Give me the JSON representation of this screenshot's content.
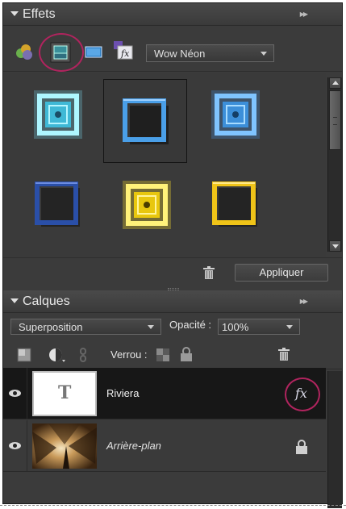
{
  "effects_panel": {
    "title": "Effets",
    "category_dropdown": {
      "selected": "Wow Néon"
    },
    "tabs": [
      {
        "icon": "filters-icon"
      },
      {
        "icon": "layer-styles-icon",
        "active": true
      },
      {
        "icon": "photo-effects-icon"
      },
      {
        "icon": "fx-all-icon"
      }
    ],
    "thumbnails": [
      {
        "style": "neon-glow-cyan"
      },
      {
        "style": "blue-bevel-shadow",
        "selected": true
      },
      {
        "style": "neon-glow-blue"
      },
      {
        "style": "dark-blue-bevel"
      },
      {
        "style": "neon-glow-yellow"
      },
      {
        "style": "yellow-bevel-shadow"
      }
    ],
    "apply_label": "Appliquer"
  },
  "layers_panel": {
    "title": "Calques",
    "blend_mode": "Superposition",
    "opacity_label": "Opacité :",
    "opacity_value": "100%",
    "lock_label": "Verrou :",
    "layers": [
      {
        "name": "Riviera",
        "type": "text",
        "thumb_glyph": "T",
        "active": true,
        "has_fx": true,
        "visible": true
      },
      {
        "name": "Arrière-plan",
        "type": "image",
        "locked": true,
        "visible": true
      }
    ],
    "fx_label": "fx"
  },
  "colors": {
    "panel_bg": "#3b3b3b",
    "highlight_ring": "#b0245e",
    "neon_cyan": "#7fe6ff",
    "neon_blue": "#4aa2ff",
    "neon_yellow": "#ffe22a"
  }
}
